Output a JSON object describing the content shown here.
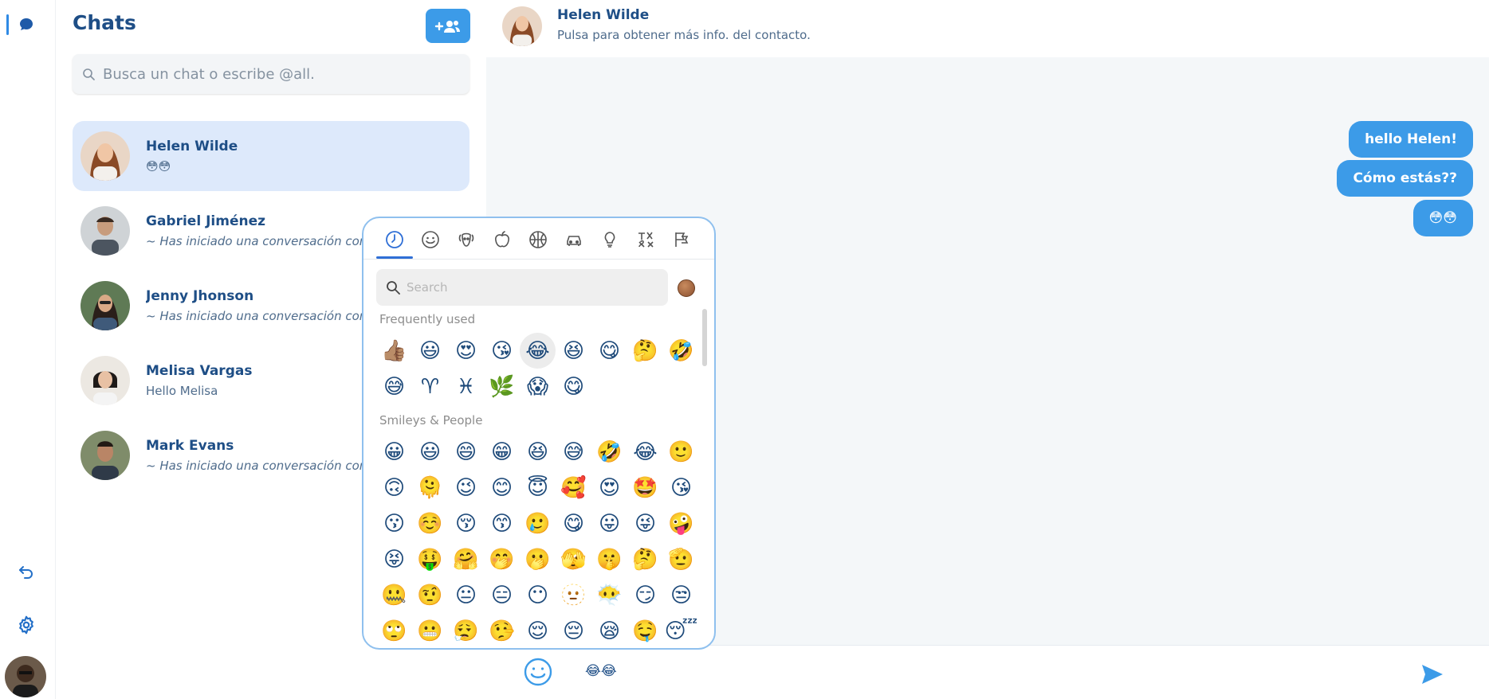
{
  "sidebar": {
    "title": "Chats",
    "search_placeholder": "Busca un chat o escribe @all.",
    "new_chat_label": "+👥"
  },
  "chats": [
    {
      "name": "Helen Wilde",
      "preview": "😳😳",
      "active": true
    },
    {
      "name": "Gabriel Jiménez",
      "preview": "~ Has iniciado una conversación con",
      "active": false
    },
    {
      "name": "Jenny Jhonson",
      "preview": "~ Has iniciado una conversación con",
      "active": false
    },
    {
      "name": "Melisa Vargas",
      "preview": "Hello Melisa",
      "active": false
    },
    {
      "name": "Mark Evans",
      "preview": "~ Has iniciado una conversación con",
      "active": false
    }
  ],
  "conversation": {
    "contact_name": "Helen Wilde",
    "contact_subtitle": "Pulsa para obtener más info. del contacto.",
    "messages": [
      "hello Helen!",
      "Cómo estás??",
      "😳😳"
    ],
    "composer_text": "😂😂"
  },
  "emoji_picker": {
    "search_placeholder": "Search",
    "tabs": [
      "recent-icon",
      "smiley-icon",
      "animal-icon",
      "food-icon",
      "activity-icon",
      "travel-icon",
      "objects-icon",
      "symbols-icon",
      "flags-icon"
    ],
    "active_tab": "recent-icon",
    "sections": {
      "frequent": {
        "label": "Frequently used",
        "emojis": [
          "👍🏽",
          "😃",
          "😍",
          "😘",
          "😂",
          "😆",
          "😋",
          "🤔",
          "🤣",
          "😅",
          "♈",
          "♓",
          "🌿",
          "😱",
          "😋"
        ]
      },
      "smileys": {
        "label": "Smileys & People",
        "emojis": [
          "😀",
          "😃",
          "😄",
          "😁",
          "😆",
          "😅",
          "🤣",
          "😂",
          "🙂",
          "🙃",
          "🫠",
          "😉",
          "😊",
          "😇",
          "🥰",
          "😍",
          "🤩",
          "😘",
          "😗",
          "☺️",
          "😚",
          "😙",
          "🥲",
          "😋",
          "😛",
          "😜",
          "🤪",
          "😝",
          "🤑",
          "🤗",
          "🤭",
          "🫢",
          "🫣",
          "🤫",
          "🤔",
          "🫡",
          "🤐",
          "🤨",
          "😐",
          "😑",
          "😶",
          "🫥",
          "😶‍🌫️",
          "😏",
          "😒",
          "🙄",
          "😬",
          "😮‍💨",
          "🤥",
          "😌",
          "😔",
          "😪",
          "🤤",
          "😴"
        ]
      }
    },
    "highlighted_index": 4
  },
  "colors": {
    "accent": "#3c9be8",
    "active_chat_bg": "#dde9fb",
    "title_text": "#1e4e86",
    "conversation_bg": "#f4f7f9",
    "picker_border": "#8fc0ee"
  }
}
